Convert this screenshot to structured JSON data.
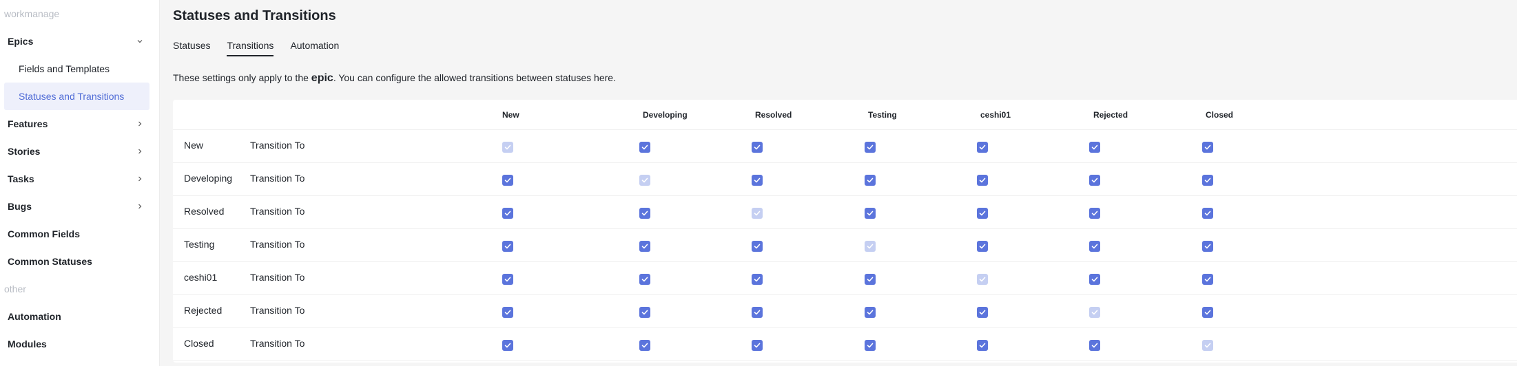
{
  "sidebar": {
    "section_workmanage": "workmanage",
    "epics": {
      "label": "Epics",
      "icon": "chevron-down-icon"
    },
    "epic_children": [
      {
        "label": "Fields and Templates",
        "active": false
      },
      {
        "label": "Statuses and Transitions",
        "active": true
      }
    ],
    "items": [
      {
        "label": "Features",
        "icon": "chevron-right-icon"
      },
      {
        "label": "Stories",
        "icon": "chevron-right-icon"
      },
      {
        "label": "Tasks",
        "icon": "chevron-right-icon"
      },
      {
        "label": "Bugs",
        "icon": "chevron-right-icon"
      }
    ],
    "common_fields": "Common Fields",
    "common_statuses": "Common Statuses",
    "section_other": "other",
    "automation": "Automation",
    "modules": "Modules"
  },
  "page": {
    "title": "Statuses and Transitions",
    "tabs": [
      {
        "label": "Statuses",
        "active": false
      },
      {
        "label": "Transitions",
        "active": true
      },
      {
        "label": "Automation",
        "active": false
      }
    ],
    "note_pre": "These settings only apply to the ",
    "note_strong": "epic",
    "note_post": ". You can configure the allowed transitions between statuses here."
  },
  "matrix": {
    "columns": [
      "New",
      "Developing",
      "Resolved",
      "Testing",
      "ceshi01",
      "Rejected",
      "Closed"
    ],
    "row_sublabel": "Transition To",
    "rows": [
      {
        "label": "New",
        "checked": [
          true,
          true,
          true,
          true,
          true,
          true,
          true
        ]
      },
      {
        "label": "Developing",
        "checked": [
          true,
          true,
          true,
          true,
          true,
          true,
          true
        ]
      },
      {
        "label": "Resolved",
        "checked": [
          true,
          true,
          true,
          true,
          true,
          true,
          true
        ]
      },
      {
        "label": "Testing",
        "checked": [
          true,
          true,
          true,
          true,
          true,
          true,
          true
        ]
      },
      {
        "label": "ceshi01",
        "checked": [
          true,
          true,
          true,
          true,
          true,
          true,
          true
        ]
      },
      {
        "label": "Rejected",
        "checked": [
          true,
          true,
          true,
          true,
          true,
          true,
          true
        ]
      },
      {
        "label": "Closed",
        "checked": [
          true,
          true,
          true,
          true,
          true,
          true,
          true
        ]
      }
    ]
  },
  "colors": {
    "accent": "#5b74dc",
    "accent_disabled": "#c5cff2",
    "active_nav_bg": "#eef0fb",
    "active_nav_text": "#4f6bd6"
  }
}
